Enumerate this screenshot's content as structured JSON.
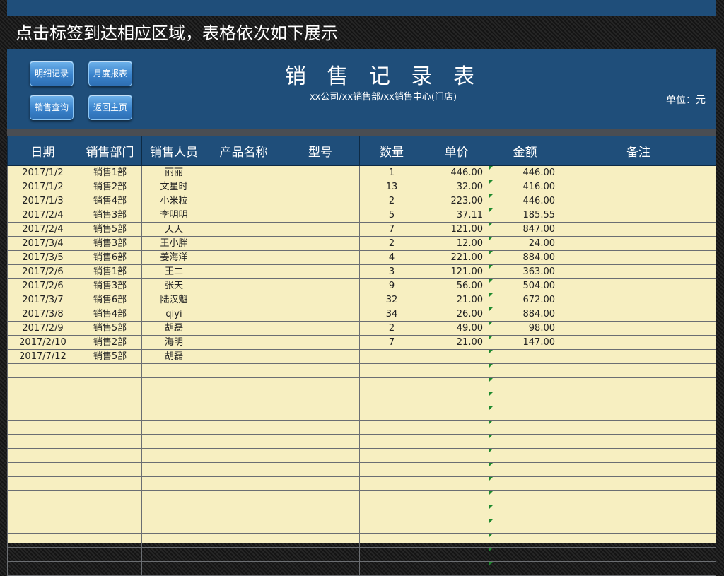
{
  "banner": "点击标签到达相应区域，表格依次如下展示",
  "nav": {
    "detail": "明细记录",
    "monthly": "月度报表",
    "query": "销售查询",
    "home": "返回主页"
  },
  "title": "销 售 记 录 表",
  "subtitle": "xx公司/xx销售部/xx销售中心(门店)",
  "unit": "单位：元",
  "columns": [
    "日期",
    "销售部门",
    "销售人员",
    "产品名称",
    "型号",
    "数量",
    "单价",
    "金额",
    "备注"
  ],
  "rows": [
    {
      "date": "2017/1/2",
      "dept": "销售1部",
      "person": "丽丽",
      "product": "",
      "model": "",
      "qty": "1",
      "price": "446.00",
      "amount": "446.00",
      "note": ""
    },
    {
      "date": "2017/1/2",
      "dept": "销售2部",
      "person": "文星时",
      "product": "",
      "model": "",
      "qty": "13",
      "price": "32.00",
      "amount": "416.00",
      "note": ""
    },
    {
      "date": "2017/1/3",
      "dept": "销售4部",
      "person": "小米粒",
      "product": "",
      "model": "",
      "qty": "2",
      "price": "223.00",
      "amount": "446.00",
      "note": ""
    },
    {
      "date": "2017/2/4",
      "dept": "销售3部",
      "person": "李明明",
      "product": "",
      "model": "",
      "qty": "5",
      "price": "37.11",
      "amount": "185.55",
      "note": ""
    },
    {
      "date": "2017/2/4",
      "dept": "销售5部",
      "person": "天天",
      "product": "",
      "model": "",
      "qty": "7",
      "price": "121.00",
      "amount": "847.00",
      "note": ""
    },
    {
      "date": "2017/3/4",
      "dept": "销售3部",
      "person": "王小胖",
      "product": "",
      "model": "",
      "qty": "2",
      "price": "12.00",
      "amount": "24.00",
      "note": ""
    },
    {
      "date": "2017/3/5",
      "dept": "销售6部",
      "person": "姜海洋",
      "product": "",
      "model": "",
      "qty": "4",
      "price": "221.00",
      "amount": "884.00",
      "note": ""
    },
    {
      "date": "2017/2/6",
      "dept": "销售1部",
      "person": "王二",
      "product": "",
      "model": "",
      "qty": "3",
      "price": "121.00",
      "amount": "363.00",
      "note": ""
    },
    {
      "date": "2017/2/6",
      "dept": "销售3部",
      "person": "张天",
      "product": "",
      "model": "",
      "qty": "9",
      "price": "56.00",
      "amount": "504.00",
      "note": ""
    },
    {
      "date": "2017/3/7",
      "dept": "销售6部",
      "person": "陆汉魁",
      "product": "",
      "model": "",
      "qty": "32",
      "price": "21.00",
      "amount": "672.00",
      "note": ""
    },
    {
      "date": "2017/3/8",
      "dept": "销售4部",
      "person": "qiyi",
      "product": "",
      "model": "",
      "qty": "34",
      "price": "26.00",
      "amount": "884.00",
      "note": ""
    },
    {
      "date": "2017/2/9",
      "dept": "销售5部",
      "person": "胡磊",
      "product": "",
      "model": "",
      "qty": "2",
      "price": "49.00",
      "amount": "98.00",
      "note": ""
    },
    {
      "date": "2017/2/10",
      "dept": "销售2部",
      "person": "海明",
      "product": "",
      "model": "",
      "qty": "7",
      "price": "21.00",
      "amount": "147.00",
      "note": ""
    },
    {
      "date": "2017/7/12",
      "dept": "销售5部",
      "person": "胡磊",
      "product": "",
      "model": "",
      "qty": "",
      "price": "",
      "amount": "",
      "note": ""
    },
    {
      "date": "",
      "dept": "",
      "person": "",
      "product": "",
      "model": "",
      "qty": "",
      "price": "",
      "amount": "",
      "note": ""
    },
    {
      "date": "",
      "dept": "",
      "person": "",
      "product": "",
      "model": "",
      "qty": "",
      "price": "",
      "amount": "",
      "note": ""
    },
    {
      "date": "",
      "dept": "",
      "person": "",
      "product": "",
      "model": "",
      "qty": "",
      "price": "",
      "amount": "",
      "note": ""
    },
    {
      "date": "",
      "dept": "",
      "person": "",
      "product": "",
      "model": "",
      "qty": "",
      "price": "",
      "amount": "",
      "note": ""
    },
    {
      "date": "",
      "dept": "",
      "person": "",
      "product": "",
      "model": "",
      "qty": "",
      "price": "",
      "amount": "",
      "note": ""
    },
    {
      "date": "",
      "dept": "",
      "person": "",
      "product": "",
      "model": "",
      "qty": "",
      "price": "",
      "amount": "",
      "note": ""
    },
    {
      "date": "",
      "dept": "",
      "person": "",
      "product": "",
      "model": "",
      "qty": "",
      "price": "",
      "amount": "",
      "note": ""
    },
    {
      "date": "",
      "dept": "",
      "person": "",
      "product": "",
      "model": "",
      "qty": "",
      "price": "",
      "amount": "",
      "note": ""
    },
    {
      "date": "",
      "dept": "",
      "person": "",
      "product": "",
      "model": "",
      "qty": "",
      "price": "",
      "amount": "",
      "note": ""
    },
    {
      "date": "",
      "dept": "",
      "person": "",
      "product": "",
      "model": "",
      "qty": "",
      "price": "",
      "amount": "",
      "note": ""
    },
    {
      "date": "",
      "dept": "",
      "person": "",
      "product": "",
      "model": "",
      "qty": "",
      "price": "",
      "amount": "",
      "note": ""
    },
    {
      "date": "",
      "dept": "",
      "person": "",
      "product": "",
      "model": "",
      "qty": "",
      "price": "",
      "amount": "",
      "note": ""
    },
    {
      "date": "",
      "dept": "",
      "person": "",
      "product": "",
      "model": "",
      "qty": "",
      "price": "",
      "amount": "",
      "note": ""
    },
    {
      "date": "",
      "dept": "",
      "person": "",
      "product": "",
      "model": "",
      "qty": "",
      "price": "",
      "amount": "",
      "note": ""
    },
    {
      "date": "",
      "dept": "",
      "person": "",
      "product": "",
      "model": "",
      "qty": "",
      "price": "",
      "amount": "",
      "note": ""
    }
  ]
}
